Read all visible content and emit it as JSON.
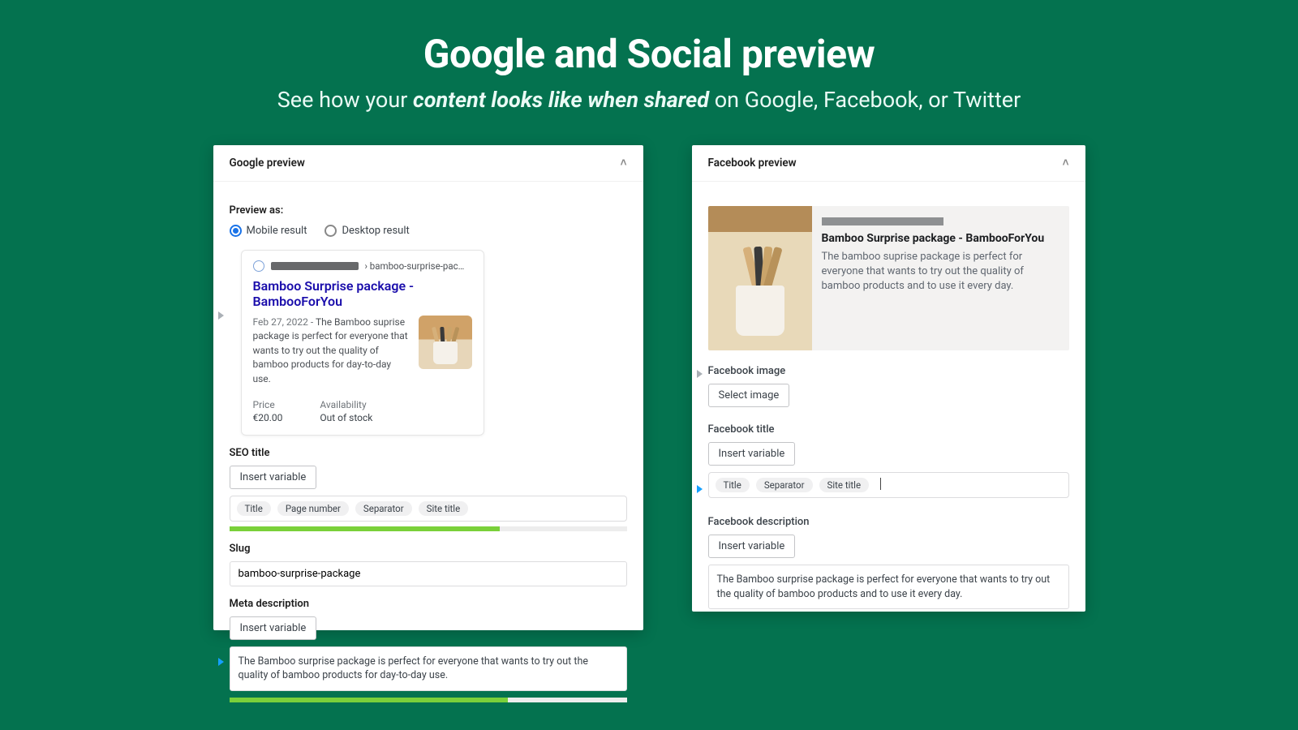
{
  "hero": {
    "title": "Google and Social preview",
    "subtitle_prefix": "See how your ",
    "subtitle_em": "content looks like when shared",
    "subtitle_suffix": " on Google, Facebook, or Twitter"
  },
  "google": {
    "panel_title": "Google preview",
    "preview_as": "Preview as:",
    "mobile": "Mobile result",
    "desktop": "Desktop result",
    "breadcrumb_tail": "› bamboo-surprise-pac…",
    "serp_title": "Bamboo Surprise package - BambooForYou",
    "serp_date": "Feb 27, 2022 - ",
    "serp_desc": "The Bamboo suprise package is perfect for everyone that wants to try out the quality of bamboo products for day-to-day use.",
    "price_label": "Price",
    "price_value": "€20.00",
    "avail_label": "Availability",
    "avail_value": "Out of stock",
    "seo_title_label": "SEO title",
    "insert_variable": "Insert variable",
    "chip_title": "Title",
    "chip_page": "Page number",
    "chip_sep": "Separator",
    "chip_site": "Site title",
    "slug_label": "Slug",
    "slug_value": "bamboo-surprise-package",
    "meta_label": "Meta description",
    "meta_value": "The Bamboo surprise package is perfect for everyone that wants to try out the quality of bamboo products for day-to-day use."
  },
  "facebook": {
    "panel_title": "Facebook preview",
    "card_title": "Bamboo Surprise package - BambooForYou",
    "card_desc": "The bamboo suprise package is perfect for everyone that wants to try out the quality of bamboo products and to use it every day.",
    "img_label": "Facebook image",
    "select_image": "Select image",
    "title_label": "Facebook title",
    "insert_variable": "Insert variable",
    "chip_title": "Title",
    "chip_sep": "Separator",
    "chip_site": "Site title",
    "desc_label": "Facebook description",
    "desc_value": "The Bamboo surprise package is perfect for everyone that wants to try out the quality of bamboo products and to use it every day."
  }
}
